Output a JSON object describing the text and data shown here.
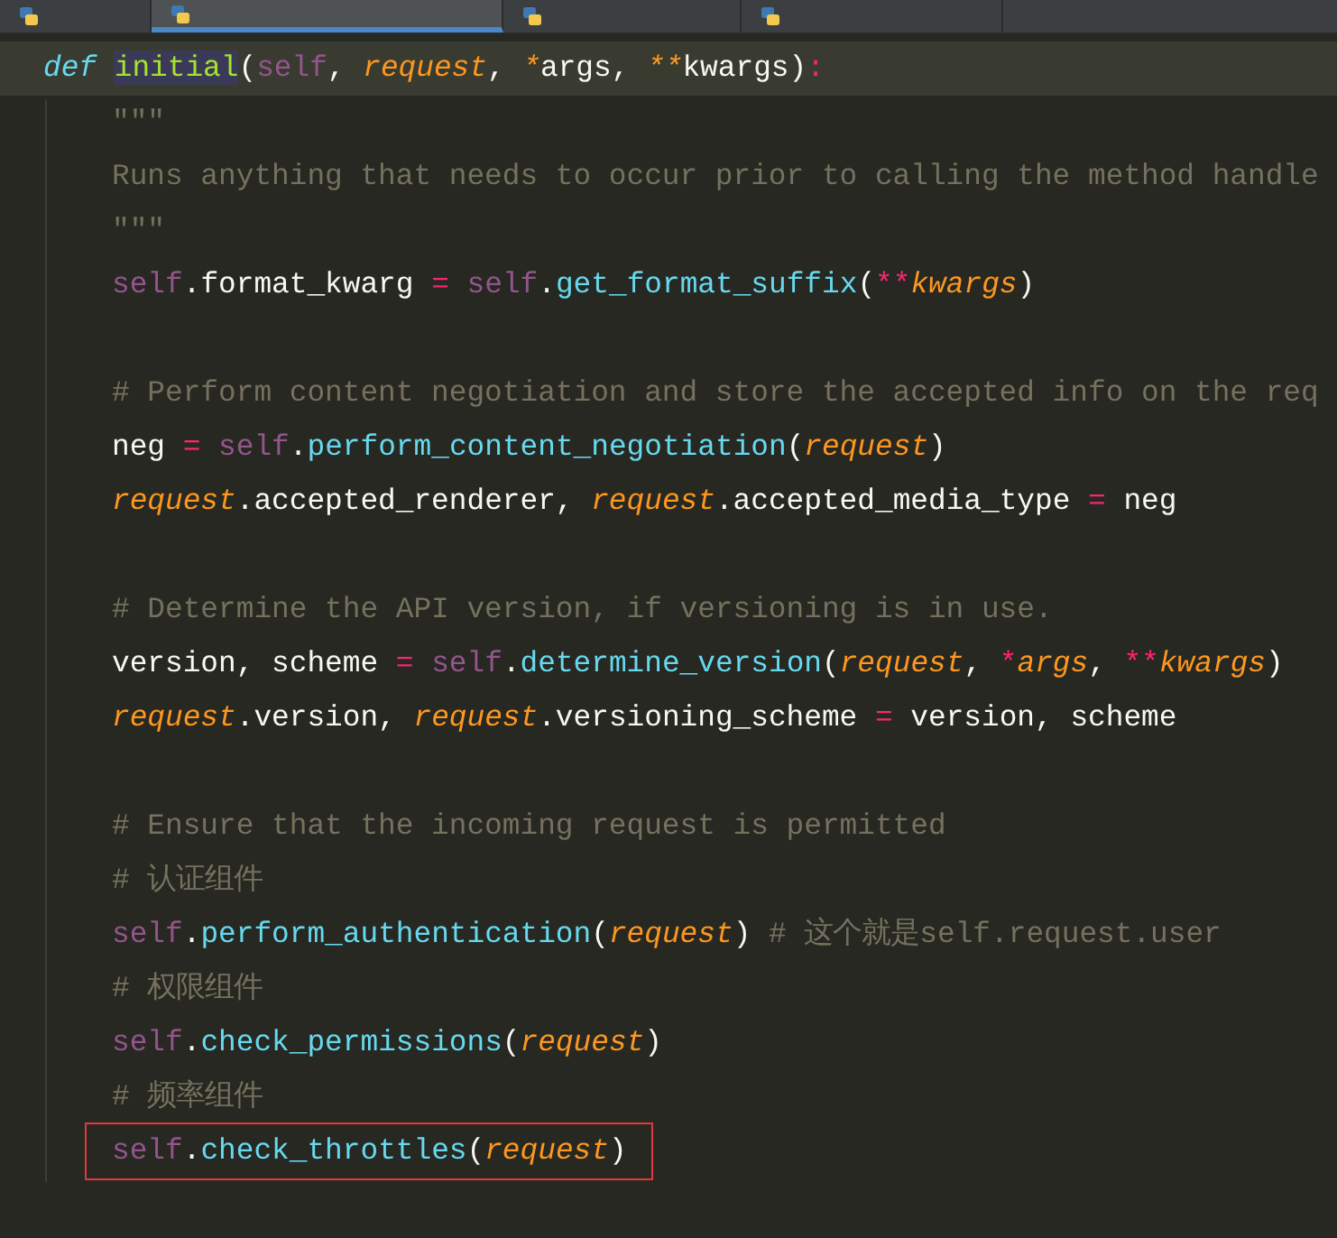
{
  "tabs": [
    {
      "selected": false
    },
    {
      "selected": true
    },
    {
      "selected": false
    },
    {
      "selected": false
    }
  ],
  "signature": {
    "current": true,
    "boxed": false,
    "tokens": [
      {
        "kind": "kw",
        "text": "def "
      },
      {
        "kind": "defname",
        "text": "initial"
      },
      {
        "kind": "plain",
        "text": "("
      },
      {
        "kind": "self",
        "text": "self"
      },
      {
        "kind": "plain",
        "text": ", "
      },
      {
        "kind": "param",
        "text": "request"
      },
      {
        "kind": "plain",
        "text": ", "
      },
      {
        "kind": "param",
        "text": "*"
      },
      {
        "kind": "plain",
        "text": "args, "
      },
      {
        "kind": "param",
        "text": "**"
      },
      {
        "kind": "plain",
        "text": "kwargs)"
      },
      {
        "kind": "op",
        "text": ":"
      }
    ]
  },
  "body": [
    {
      "current": false,
      "boxed": false,
      "tokens": [
        {
          "kind": "doc",
          "text": "\"\"\""
        }
      ]
    },
    {
      "current": false,
      "boxed": false,
      "tokens": [
        {
          "kind": "doc",
          "text": "Runs anything that needs to occur prior to calling the method handle"
        }
      ]
    },
    {
      "current": false,
      "boxed": false,
      "tokens": [
        {
          "kind": "doc",
          "text": "\"\"\""
        }
      ]
    },
    {
      "current": false,
      "boxed": false,
      "tokens": [
        {
          "kind": "self",
          "text": "self"
        },
        {
          "kind": "plain",
          "text": ".format_kwarg "
        },
        {
          "kind": "op",
          "text": "= "
        },
        {
          "kind": "self",
          "text": "self"
        },
        {
          "kind": "plain",
          "text": "."
        },
        {
          "kind": "call",
          "text": "get_format_suffix"
        },
        {
          "kind": "plain",
          "text": "("
        },
        {
          "kind": "op",
          "text": "**"
        },
        {
          "kind": "param",
          "text": "kwargs"
        },
        {
          "kind": "plain",
          "text": ")"
        }
      ]
    },
    {
      "current": false,
      "boxed": false
    },
    {
      "current": false,
      "boxed": false,
      "tokens": [
        {
          "kind": "comment",
          "text": "# Perform content negotiation and store the accepted info on the req"
        }
      ]
    },
    {
      "current": false,
      "boxed": false,
      "tokens": [
        {
          "kind": "plain",
          "text": "neg "
        },
        {
          "kind": "op",
          "text": "= "
        },
        {
          "kind": "self",
          "text": "self"
        },
        {
          "kind": "plain",
          "text": "."
        },
        {
          "kind": "call",
          "text": "perform_content_negotiation"
        },
        {
          "kind": "plain",
          "text": "("
        },
        {
          "kind": "param",
          "text": "request"
        },
        {
          "kind": "plain",
          "text": ")"
        }
      ]
    },
    {
      "current": false,
      "boxed": false,
      "tokens": [
        {
          "kind": "param",
          "text": "request"
        },
        {
          "kind": "plain",
          "text": ".accepted_renderer, "
        },
        {
          "kind": "param",
          "text": "request"
        },
        {
          "kind": "plain",
          "text": ".accepted_media_type "
        },
        {
          "kind": "op",
          "text": "="
        },
        {
          "kind": "plain",
          "text": " neg"
        }
      ]
    },
    {
      "current": false,
      "boxed": false
    },
    {
      "current": false,
      "boxed": false,
      "tokens": [
        {
          "kind": "comment",
          "text": "# Determine the API version, if versioning is in use."
        }
      ]
    },
    {
      "current": false,
      "boxed": false,
      "tokens": [
        {
          "kind": "plain",
          "text": "version, scheme "
        },
        {
          "kind": "op",
          "text": "= "
        },
        {
          "kind": "self",
          "text": "self"
        },
        {
          "kind": "plain",
          "text": "."
        },
        {
          "kind": "call",
          "text": "determine_version"
        },
        {
          "kind": "plain",
          "text": "("
        },
        {
          "kind": "param",
          "text": "request"
        },
        {
          "kind": "plain",
          "text": ", "
        },
        {
          "kind": "op",
          "text": "*"
        },
        {
          "kind": "param",
          "text": "args"
        },
        {
          "kind": "plain",
          "text": ", "
        },
        {
          "kind": "op",
          "text": "**"
        },
        {
          "kind": "param",
          "text": "kwargs"
        },
        {
          "kind": "plain",
          "text": ")"
        }
      ]
    },
    {
      "current": false,
      "boxed": false,
      "tokens": [
        {
          "kind": "param",
          "text": "request"
        },
        {
          "kind": "plain",
          "text": ".version, "
        },
        {
          "kind": "param",
          "text": "request"
        },
        {
          "kind": "plain",
          "text": ".versioning_scheme "
        },
        {
          "kind": "op",
          "text": "="
        },
        {
          "kind": "plain",
          "text": " version, scheme"
        }
      ]
    },
    {
      "current": false,
      "boxed": false
    },
    {
      "current": false,
      "boxed": false,
      "tokens": [
        {
          "kind": "comment",
          "text": "# Ensure that the incoming request is permitted"
        }
      ]
    },
    {
      "current": false,
      "boxed": false,
      "tokens": [
        {
          "kind": "comment",
          "text": "# 认证组件"
        }
      ]
    },
    {
      "current": false,
      "boxed": false,
      "tokens": [
        {
          "kind": "self",
          "text": "self"
        },
        {
          "kind": "plain",
          "text": "."
        },
        {
          "kind": "call",
          "text": "perform_authentication"
        },
        {
          "kind": "plain",
          "text": "("
        },
        {
          "kind": "param",
          "text": "request"
        },
        {
          "kind": "plain",
          "text": ") "
        },
        {
          "kind": "comment",
          "text": "# 这个就是self.request.user"
        }
      ]
    },
    {
      "current": false,
      "boxed": false,
      "tokens": [
        {
          "kind": "comment",
          "text": "# 权限组件"
        }
      ]
    },
    {
      "current": false,
      "boxed": false,
      "tokens": [
        {
          "kind": "self",
          "text": "self"
        },
        {
          "kind": "plain",
          "text": "."
        },
        {
          "kind": "call",
          "text": "check_permissions"
        },
        {
          "kind": "plain",
          "text": "("
        },
        {
          "kind": "param",
          "text": "request"
        },
        {
          "kind": "plain",
          "text": ")"
        }
      ]
    },
    {
      "current": false,
      "boxed": false,
      "tokens": [
        {
          "kind": "comment",
          "text": "# 频率组件"
        }
      ]
    },
    {
      "current": false,
      "boxed": true,
      "tokens": [
        {
          "kind": "self",
          "text": "self"
        },
        {
          "kind": "plain",
          "text": "."
        },
        {
          "kind": "call",
          "text": "check_throttles"
        },
        {
          "kind": "plain",
          "text": "("
        },
        {
          "kind": "param",
          "text": "request"
        },
        {
          "kind": "plain",
          "text": ")"
        }
      ]
    }
  ]
}
